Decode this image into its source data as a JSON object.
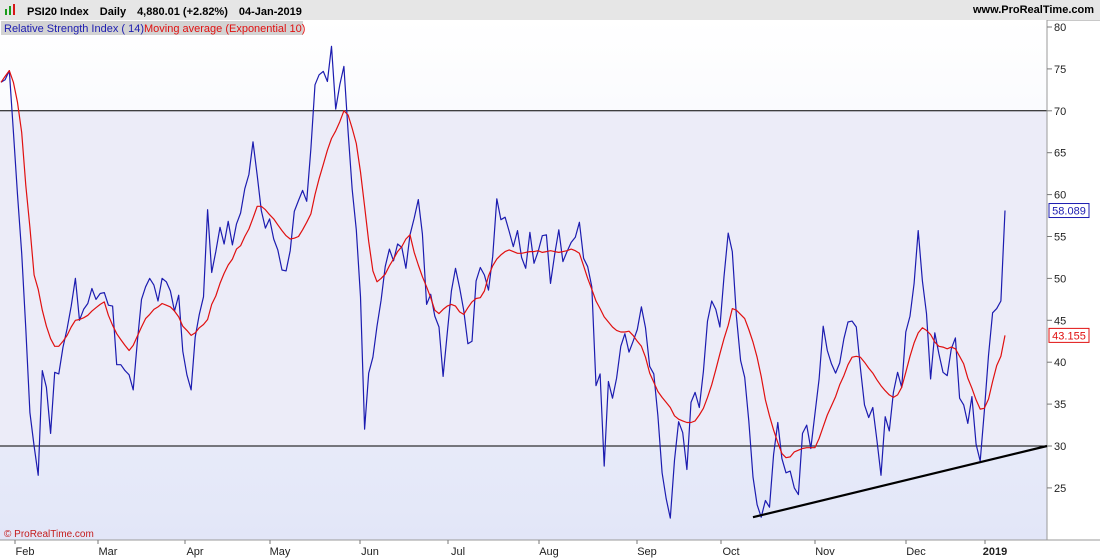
{
  "header": {
    "instrument": "PSI20 Index",
    "period": "Daily",
    "price_change": "4,880.01 (+2.82%)",
    "date": "04-Jan-2019",
    "site": "www.ProRealTime.com"
  },
  "watermark": "© ProRealTime.com",
  "colors": {
    "rsi": "#1c1cb0",
    "ema": "#e01010",
    "band": "#ececf8",
    "levels": "#000000",
    "trendline": "#000000"
  },
  "chart_data": {
    "type": "line",
    "legend": [
      "Relative Strength Index ( 14)",
      "Moving average (Exponential 10)"
    ],
    "x_ticks": [
      "Feb",
      "Mar",
      "Apr",
      "May",
      "Jun",
      "Jul",
      "Aug",
      "Sep",
      "Oct",
      "Nov",
      "Dec",
      "2019"
    ],
    "y_ticks": [
      25,
      30,
      35,
      40,
      45,
      50,
      55,
      60,
      65,
      70,
      75,
      80
    ],
    "ylim": [
      19,
      81
    ],
    "reference_levels": [
      30,
      70
    ],
    "series": [
      {
        "name": "Relative Strength Index ( 14)",
        "last_value": "58.089",
        "values": [
          73.4,
          73.7,
          74.8,
          67.5,
          60,
          53,
          44,
          34,
          30,
          26.5,
          39,
          37,
          31.5,
          38.8,
          38.6,
          41.8,
          44,
          46.7,
          50,
          45,
          46.3,
          47,
          48.8,
          47.5,
          48.2,
          48.3,
          46.8,
          46.7,
          39.7,
          39.7,
          39,
          38.5,
          36.7,
          42.4,
          47.5,
          49,
          50,
          49.2,
          47.3,
          50,
          49.6,
          48.5,
          46.1,
          48,
          41.3,
          38.5,
          36.7,
          43,
          45.7,
          47.8,
          58.2,
          50.7,
          53.2,
          56.1,
          54.1,
          56.8,
          54,
          56.5,
          57.8,
          60.7,
          62.4,
          66.3,
          62.3,
          58.1,
          56,
          57.1,
          54.7,
          53.4,
          51,
          50.9,
          53.3,
          58,
          59.3,
          60.5,
          59.2,
          65.5,
          73.1,
          74.3,
          74.7,
          73.5,
          77.7,
          70.2,
          73.1,
          75.3,
          67.5,
          60.6,
          55.8,
          47.8,
          32,
          38.7,
          40.6,
          44.3,
          47.4,
          51.4,
          53.5,
          52.1,
          54.1,
          53.7,
          51.2,
          55.2,
          57.2,
          59.4,
          55.3,
          46.9,
          48.1,
          45.5,
          44.2,
          38.3,
          43.4,
          48.5,
          51.2,
          48.9,
          46.2,
          42.2,
          42.5,
          49.7,
          51.3,
          50.4,
          48.6,
          52.6,
          59.5,
          57,
          57.3,
          55.6,
          53.8,
          55.7,
          52.5,
          51.2,
          55.5,
          51.8,
          53.2,
          55.1,
          55.2,
          49.4,
          52.8,
          55.8,
          52,
          53.2,
          54.3,
          54.9,
          56.7,
          52.4,
          51.4,
          49,
          37.2,
          38.6,
          27.6,
          37.7,
          35.7,
          38.1,
          41.9,
          43.4,
          41.2,
          42.5,
          43.9,
          46.6,
          44.1,
          39.5,
          38.6,
          33.6,
          26.8,
          23.7,
          21.4,
          28.3,
          32.9,
          31.6,
          27.2,
          35.2,
          36.4,
          34.6,
          38.9,
          44.9,
          47.3,
          46.3,
          44.2,
          50.2,
          55.4,
          53.2,
          45.5,
          40.2,
          38.2,
          33,
          26.3,
          23,
          21.5,
          23.5,
          22.7,
          29,
          32.8,
          28.5,
          26.8,
          27,
          25,
          24.2,
          31.5,
          32.5,
          29.7,
          33.8,
          38,
          44.3,
          41.4,
          39.8,
          38.7,
          39.9,
          42.8,
          44.8,
          44.9,
          44.2,
          39.3,
          34.9,
          33.4,
          34.6,
          30.7,
          26.5,
          33.5,
          31.8,
          36.4,
          38.8,
          37,
          43.6,
          45.5,
          49.4,
          55.7,
          49.7,
          45.8,
          38,
          43.5,
          41,
          38.8,
          38.4,
          41.6,
          42.9,
          35.7,
          34.9,
          32.7,
          35.9,
          30.2,
          28.2,
          34.1,
          40.8,
          45.9,
          46.4,
          47.3,
          58.1
        ]
      },
      {
        "name": "Moving average (Exponential 10)",
        "last_value": "43.155",
        "values": [
          73.4,
          74.1,
          74.8,
          73.4,
          71,
          67.4,
          61.1,
          56.1,
          50.4,
          48.7,
          46.2,
          44.3,
          42.8,
          41.9,
          41.9,
          42.5,
          43.2,
          44.2,
          45,
          45.1,
          45.3,
          45.6,
          46.1,
          46.5,
          46.9,
          47.2,
          45.6,
          44.4,
          43.4,
          42.7,
          42,
          41.4,
          42,
          43.1,
          44.2,
          45.2,
          45.7,
          46.3,
          46.6,
          47,
          46.8,
          46.6,
          46.1,
          45.4,
          44.3,
          43.8,
          43.2,
          43.5,
          44.1,
          44.5,
          45.1,
          46.9,
          47.9,
          49.4,
          50.6,
          51.6,
          52.3,
          53.5,
          53.9,
          55,
          55.9,
          57.2,
          58.6,
          58.6,
          58.2,
          57.6,
          57.1,
          56.4,
          55.7,
          55.1,
          54.7,
          54.8,
          55,
          55.8,
          56.7,
          57.7,
          60,
          61.9,
          63.6,
          65.3,
          66.7,
          67.6,
          68.7,
          70,
          69.5,
          67.9,
          66.1,
          62.7,
          58.6,
          54.4,
          50.9,
          49.6,
          50,
          50.5,
          51.5,
          52.3,
          53.2,
          53.8,
          54.7,
          55.2,
          53.1,
          51.6,
          50.2,
          49,
          47.7,
          46.2,
          45.8,
          46.3,
          46.7,
          46.9,
          46.7,
          46,
          45.7,
          46.5,
          47.2,
          47.6,
          47.7,
          48.5,
          50.3,
          51.5,
          52.3,
          52.8,
          53.2,
          53.4,
          53.2,
          53,
          53,
          53.1,
          53.2,
          53.2,
          53.3,
          53.1,
          53.2,
          53.3,
          53.2,
          53.1,
          53.2,
          53.3,
          53.5,
          53.3,
          53,
          51.5,
          50,
          48.7,
          47.3,
          46.4,
          45.4,
          44.8,
          44.2,
          43.8,
          43.6,
          43.6,
          43.7,
          43.2,
          42.5,
          41.9,
          40.6,
          38.7,
          37.6,
          36.5,
          35.8,
          35.2,
          34.6,
          33.6,
          33.2,
          33,
          32.8,
          32.8,
          33,
          33.7,
          34.5,
          35.8,
          37.3,
          39.1,
          41,
          42.8,
          44.4,
          46.4,
          46.2,
          45.7,
          45.2,
          43.9,
          42.4,
          40.6,
          38.3,
          35.5,
          33.6,
          31.9,
          30.4,
          29.1,
          28.6,
          28.7,
          29.3,
          29.5,
          29.7,
          29.8,
          29.8,
          29.8,
          30.9,
          32.3,
          33.7,
          34.8,
          35.9,
          37.3,
          38.4,
          39.7,
          40.6,
          40.7,
          40.6,
          40,
          39.3,
          38.7,
          37.9,
          37.2,
          36.6,
          36.1,
          35.8,
          36.1,
          37,
          38.8,
          40.7,
          42.3,
          43.5,
          44.1,
          43.8,
          43.3,
          42.4,
          41.9,
          41.8,
          41.6,
          41.8,
          41.6,
          40.7,
          39.8,
          38.1,
          36.9,
          35.5,
          34.4,
          34.5,
          35.6,
          37.7,
          39.6,
          40.7,
          43.2
        ]
      }
    ],
    "trendline": {
      "start": [
        182,
        21.5
      ],
      "end": [
        250,
        30.0
      ]
    }
  }
}
